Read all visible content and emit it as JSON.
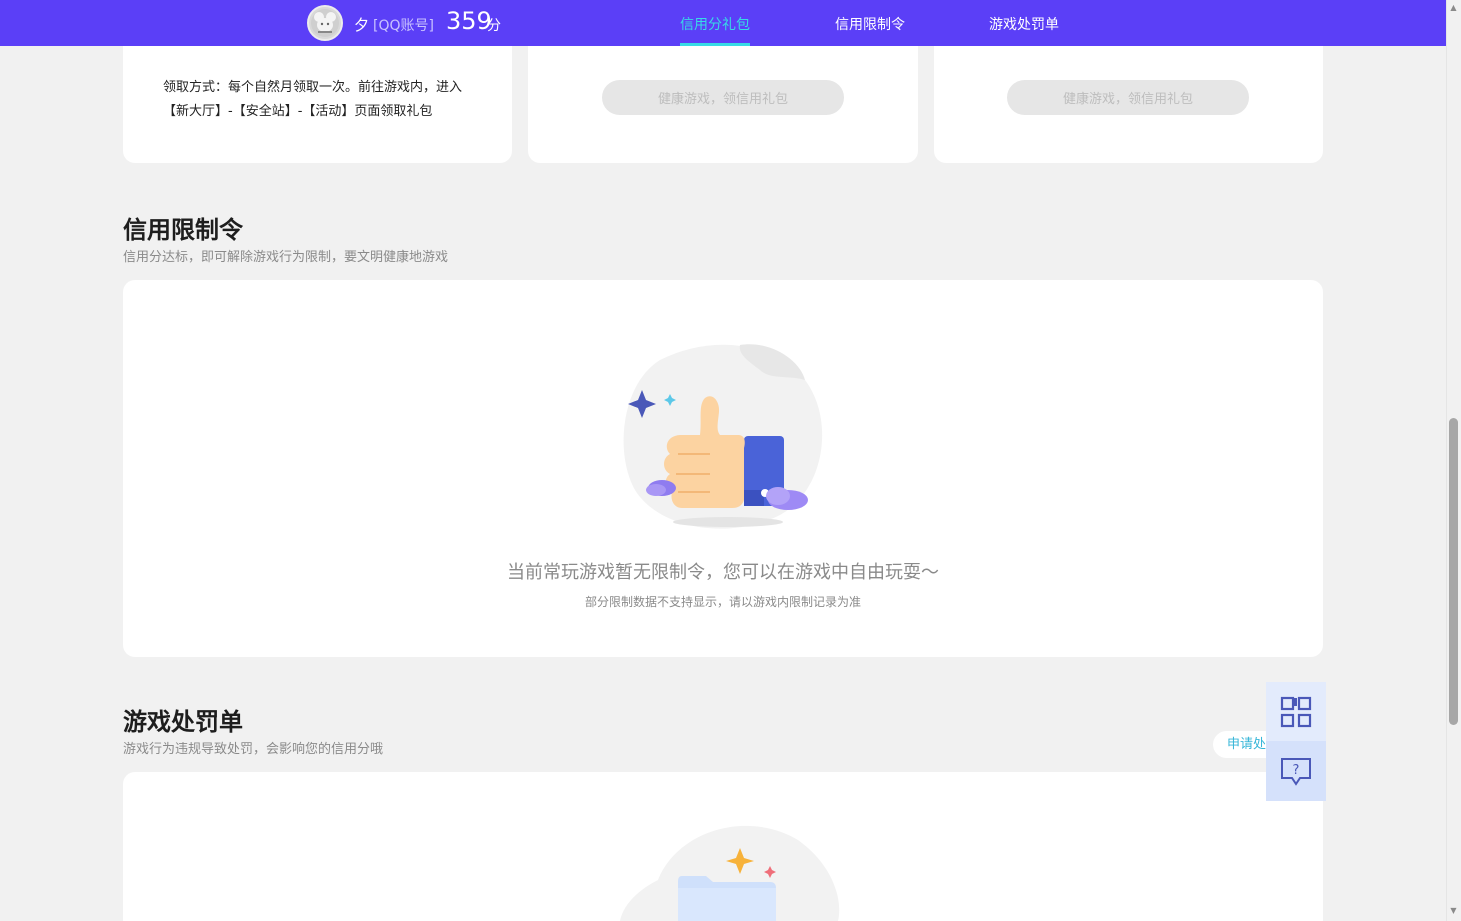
{
  "header": {
    "username": "夕",
    "account_type": "[QQ账号]",
    "score": "359",
    "score_unit": "分",
    "tabs": [
      {
        "label": "信用分礼包",
        "active": true
      },
      {
        "label": "信用限制令",
        "active": false
      },
      {
        "label": "游戏处罚单",
        "active": false
      }
    ]
  },
  "gift_cards": {
    "claim_text": "领取方式：每个自然月领取一次。前往游戏内，进入【新大厅】-【安全站】-【活动】页面领取礼包",
    "button_label_1": "健康游戏，领信用礼包",
    "button_label_2": "健康游戏，领信用礼包"
  },
  "restriction": {
    "title": "信用限制令",
    "subtitle": "信用分达标，即可解除游戏行为限制，要文明健康地游戏",
    "empty_main": "当前常玩游戏暂无限制令，您可以在游戏中自由玩耍～",
    "empty_sub": "部分限制数据不支持显示，请以游戏内限制记录为准"
  },
  "penalty": {
    "title": "游戏处罚单",
    "subtitle": "游戏行为违规导致处罚，会影响您的信用分哦",
    "apply_label": "申请处"
  },
  "side_widget": {
    "qr_icon": "qr-code-icon",
    "help_icon": "help-chat-icon"
  },
  "colors": {
    "brand": "#5b3ff7",
    "active_tab": "#37dbe6",
    "background": "#f1f1f1"
  }
}
